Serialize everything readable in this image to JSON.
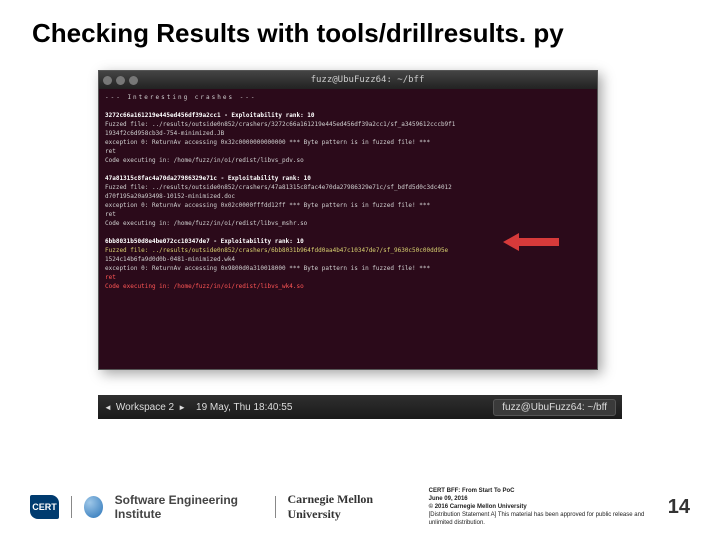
{
  "title": "Checking Results with tools/drillresults. py",
  "terminal": {
    "windowTitle": "fuzz@UbuFuzz64: ~/bff",
    "lines": [
      {
        "cls": "sep",
        "text": "--- Interesting crashes ---"
      },
      {
        "cls": "",
        "text": ""
      },
      {
        "cls": "hl-white",
        "text": "3272c66a161219e445ed456df39a2cc1 - Exploitability rank: 10"
      },
      {
        "cls": "",
        "text": "Fuzzed file: ../results/outside0n852/crashers/3272c66a161219e445ed456df39a2cc1/sf_a3459612cccb9f1"
      },
      {
        "cls": "",
        "text": "1934f2c6d958cb3d-754-minimized.JB"
      },
      {
        "cls": "",
        "text": "exception 0: ReturnAv accessing 0x32c0000000000000   *** Byte pattern is in fuzzed file! ***"
      },
      {
        "cls": "",
        "text": "ret"
      },
      {
        "cls": "",
        "text": "Code executing in: /home/fuzz/in/oi/redist/libvs_pdv.so"
      },
      {
        "cls": "",
        "text": ""
      },
      {
        "cls": "hl-white",
        "text": "47a81315c8fac4a70da27986329e71c - Exploitability rank: 10"
      },
      {
        "cls": "",
        "text": "Fuzzed file: ../results/outside0n852/crashers/47a81315c8fac4e70da27986329e71c/sf_bdfd5d0c3dc4012"
      },
      {
        "cls": "",
        "text": "d70f195a20a93498-10152-minimized.doc"
      },
      {
        "cls": "",
        "text": "exception 0: ReturnAv accessing 0x02c0000fffdd12ff   *** Byte pattern is in fuzzed file! ***"
      },
      {
        "cls": "",
        "text": "ret"
      },
      {
        "cls": "",
        "text": "Code executing in: /home/fuzz/in/oi/redist/libvs_mshr.so"
      },
      {
        "cls": "",
        "text": ""
      },
      {
        "cls": "hl-white",
        "text": "6bb8031b50d8e4be072cc10347de7 - Exploitability rank: 10"
      },
      {
        "cls": "hl-yellow",
        "text": "Fuzzed file: ../results/outside0n852/crashers/6bb8031b964fdd0aa4b47c10347de7/sf_9630c50c00dd95e"
      },
      {
        "cls": "",
        "text": "1524c14b6fa9d0d0b-0481-minimized.wk4"
      },
      {
        "cls": "",
        "text": "exception 0: ReturnAv accessing 0x9800d0a310018000   *** Byte pattern is in fuzzed file! ***"
      },
      {
        "cls": "hl-red",
        "text": "ret"
      },
      {
        "cls": "hl-red",
        "text": "Code executing in: /home/fuzz/in/oi/redist/libvs_wk4.so"
      }
    ]
  },
  "bg": {
    "cert": "CERT",
    "sei": "Software Engineering Institute",
    "cmu": "CarnegieMellon"
  },
  "taskbar": {
    "workspace": "Workspace 2",
    "datetime": "19 May, Thu 18:40:55",
    "app": "fuzz@UbuFuzz64: ~/bff"
  },
  "footer": {
    "cert": "CERT",
    "sei": "Software Engineering Institute",
    "cmu": "Carnegie Mellon University",
    "meta1": "CERT BFF: From Start To PoC",
    "meta2": "June 09, 2016",
    "meta3": "© 2016 Carnegie Mellon University",
    "meta4": "[Distribution Statement A] This material has been approved for public release and unlimited distribution.",
    "page": "14"
  }
}
